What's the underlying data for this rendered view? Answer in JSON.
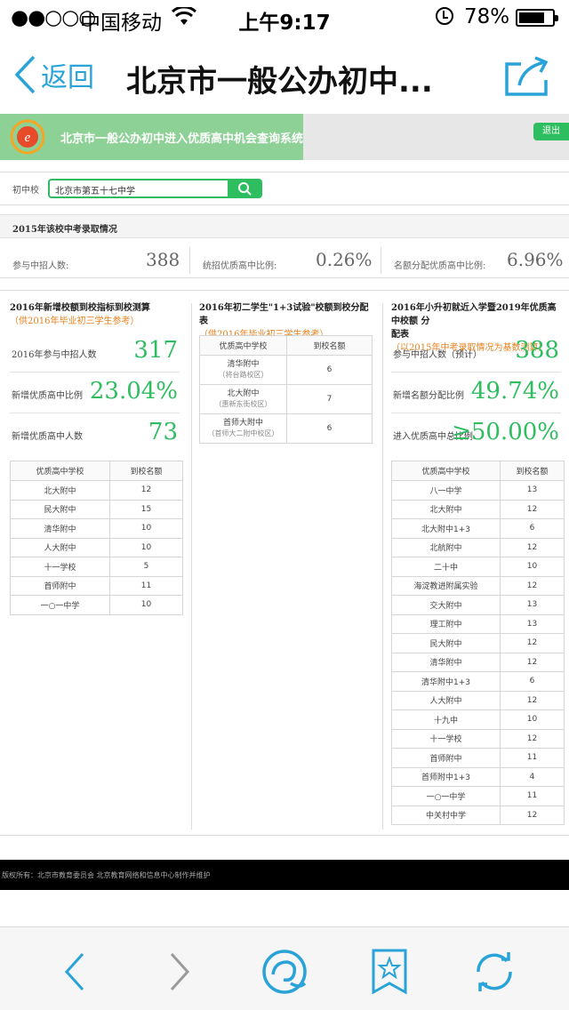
{
  "status_bar": {
    "signal": "●●○○○",
    "carrier": "中国移动",
    "time": "上午9:17",
    "battery": "78%",
    "battery_level": 0.78
  },
  "nav": {
    "back_label": "返回",
    "title": "北京市一般公办初中..."
  },
  "header": {
    "system_name": "北京市一般公办初中进入优质高中机会查询系统",
    "logout_label": "退出"
  },
  "search": {
    "label": "初中校",
    "value": "北京市第五十七中学"
  },
  "stats": {
    "heading": "2015年该校中考录取情况",
    "items": [
      {
        "label": "参与中招人数:",
        "value": "388"
      },
      {
        "label": "统招优质高中比例:",
        "value": "0.26%"
      },
      {
        "label": "名额分配优质高中比例:",
        "value": "6.96%"
      }
    ]
  },
  "col1": {
    "title": "2016年新增校额到校指标到校测算",
    "note": "（供2016年毕业初三学生参考）",
    "metrics": [
      {
        "label": "2016年参与中招人数",
        "value": "317"
      },
      {
        "label": "新增优质高中比例",
        "value": "23.04%"
      },
      {
        "label": "新增优质高中人数",
        "value": "73"
      }
    ],
    "table_headers": [
      "优质高中学校",
      "到校名额"
    ],
    "rows": [
      [
        "北大附中",
        "12"
      ],
      [
        "民大附中",
        "15"
      ],
      [
        "清华附中",
        "10"
      ],
      [
        "人大附中",
        "10"
      ],
      [
        "十一学校",
        "5"
      ],
      [
        "首师附中",
        "11"
      ],
      [
        "一○一中学",
        "10"
      ]
    ]
  },
  "col2": {
    "title": "2016年初二学生\"1+3试验\"校额到校分配表",
    "note": "（供2016年毕业初三学生参考）",
    "table_headers": [
      "优质高中学校",
      "到校名额"
    ],
    "rows": [
      {
        "school": "清华附中",
        "campus": "（将台路校区）",
        "quota": "6"
      },
      {
        "school": "北大附中",
        "campus": "（惠新东街校区）",
        "quota": "7"
      },
      {
        "school": "首师大附中",
        "campus": "（首师大二附中校区）",
        "quota": "6"
      }
    ]
  },
  "col3": {
    "title_a": "2016年小升初就近入学暨2019年优质高中校额 分",
    "title_b": "配表",
    "note": "（以2015年中考录取情况为基数测算）",
    "metrics": [
      {
        "label": "参与中招人数（预计）",
        "value": "388"
      },
      {
        "label": "新增名额分配比例",
        "value": "49.74%"
      },
      {
        "label": "进入优质高中总比例",
        "value": "≥50.00%"
      }
    ],
    "table_headers": [
      "优质高中学校",
      "到校名额"
    ],
    "rows": [
      [
        "八一中学",
        "13"
      ],
      [
        "北大附中",
        "12"
      ],
      [
        "北大附中1+3",
        "6"
      ],
      [
        "北航附中",
        "12"
      ],
      [
        "二十中",
        "10"
      ],
      [
        "海淀教进附属实验",
        "12"
      ],
      [
        "交大附中",
        "13"
      ],
      [
        "理工附中",
        "13"
      ],
      [
        "民大附中",
        "12"
      ],
      [
        "清华附中",
        "12"
      ],
      [
        "清华附中1+3",
        "6"
      ],
      [
        "人大附中",
        "12"
      ],
      [
        "十九中",
        "10"
      ],
      [
        "十一学校",
        "12"
      ],
      [
        "首师附中",
        "11"
      ],
      [
        "首师附中1+3",
        "4"
      ],
      [
        "一○一中学",
        "11"
      ],
      [
        "中关村中学",
        "12"
      ]
    ]
  },
  "footer": {
    "text": "版权所有：北京市教育委员会 北京教育网络和信息中心制作并维护"
  },
  "colors": {
    "accent_blue": "#2aa3d8",
    "green": "#2ebd5f",
    "orange_note": "#e8801c",
    "brand_green": "#8dd196"
  }
}
